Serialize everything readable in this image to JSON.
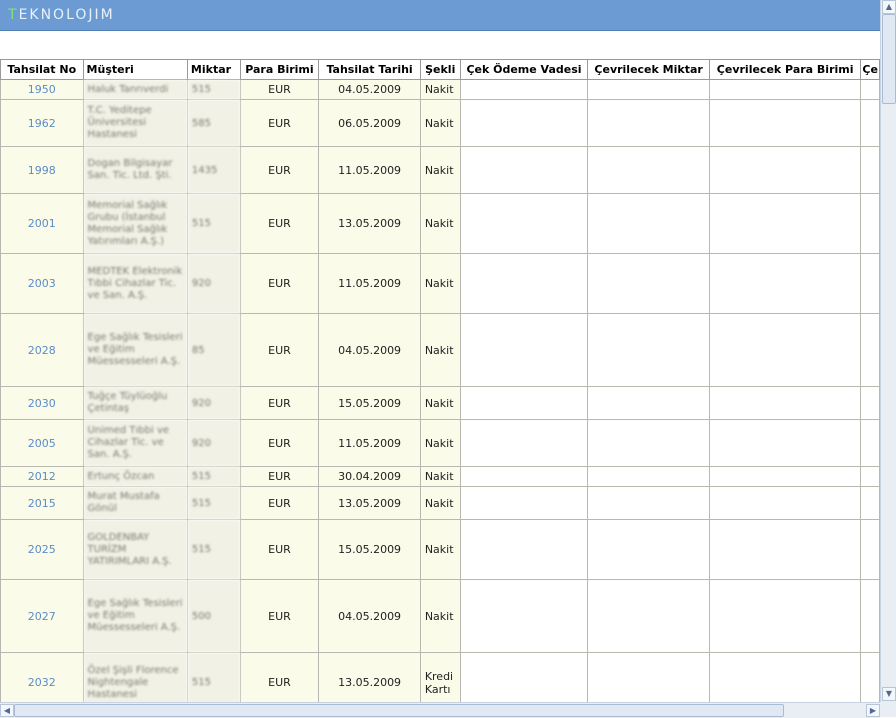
{
  "app": {
    "brand_first": "T",
    "brand_rest": "EKNOLOJIM"
  },
  "table": {
    "headers": [
      "Tahsilat No",
      "Müşteri",
      "Miktar",
      "Para Birimi",
      "Tahsilat Tarihi",
      "Şekli",
      "Çek Ödeme Vadesi",
      "Çevrilecek Miktar",
      "Çevrilecek Para Birimi",
      "Çe"
    ],
    "rows": [
      {
        "no": "1950",
        "customer": "Haluk Tanrıverdi",
        "amount": "515",
        "currency": "EUR",
        "date": "04.05.2009",
        "type": "Nakit"
      },
      {
        "no": "1962",
        "customer": "T.C. Yeditepe Üniversitesi Hastanesi",
        "amount": "585",
        "currency": "EUR",
        "date": "06.05.2009",
        "type": "Nakit"
      },
      {
        "no": "1998",
        "customer": "Dogan Bilgisayar San. Tic. Ltd. Şti.",
        "amount": "1435",
        "currency": "EUR",
        "date": "11.05.2009",
        "type": "Nakit"
      },
      {
        "no": "2001",
        "customer": "Memorial Sağlık Grubu (İstanbul Memorial Sağlık Yatırımları A.Ş.)",
        "amount": "515",
        "currency": "EUR",
        "date": "13.05.2009",
        "type": "Nakit"
      },
      {
        "no": "2003",
        "customer": "MEDTEK Elektronik Tıbbi Cihazlar Tic. ve San. A.Ş.",
        "amount": "920",
        "currency": "EUR",
        "date": "11.05.2009",
        "type": "Nakit"
      },
      {
        "no": "2028",
        "customer": "Ege Sağlık Tesisleri ve Eğitim Müessesseleri A.Ş.",
        "amount": "85",
        "currency": "EUR",
        "date": "04.05.2009",
        "type": "Nakit"
      },
      {
        "no": "2030",
        "customer": "Tuğçe Tüylüoğlu Çetintaş",
        "amount": "920",
        "currency": "EUR",
        "date": "15.05.2009",
        "type": "Nakit"
      },
      {
        "no": "2005",
        "customer": "Unimed Tıbbi ve Cihazlar Tic. ve San. A.Ş.",
        "amount": "920",
        "currency": "EUR",
        "date": "11.05.2009",
        "type": "Nakit"
      },
      {
        "no": "2012",
        "customer": "Ertunç Özcan",
        "amount": "515",
        "currency": "EUR",
        "date": "30.04.2009",
        "type": "Nakit"
      },
      {
        "no": "2015",
        "customer": "Murat Mustafa Gönül",
        "amount": "515",
        "currency": "EUR",
        "date": "13.05.2009",
        "type": "Nakit"
      },
      {
        "no": "2025",
        "customer": "GOLDENBAY TURİZM YATIRIMLARI A.Ş.",
        "amount": "515",
        "currency": "EUR",
        "date": "15.05.2009",
        "type": "Nakit"
      },
      {
        "no": "2027",
        "customer": "Ege Sağlık Tesisleri ve Eğitim Müessesseleri A.Ş.",
        "amount": "500",
        "currency": "EUR",
        "date": "04.05.2009",
        "type": "Nakit"
      },
      {
        "no": "2032",
        "customer": "Özel Şişli Florence Nightengale Hastanesi",
        "amount": "515",
        "currency": "EUR",
        "date": "13.05.2009",
        "type": "Kredi Kartı"
      }
    ]
  },
  "colors": {
    "header_bar": "#6b9bd2",
    "row_bg": "#fbfbea",
    "link": "#5b8cc7"
  },
  "icons": {
    "scroll_up": "scroll-up-arrow-icon",
    "scroll_down": "scroll-down-arrow-icon",
    "scroll_left": "scroll-left-arrow-icon",
    "scroll_right": "scroll-right-arrow-icon"
  }
}
